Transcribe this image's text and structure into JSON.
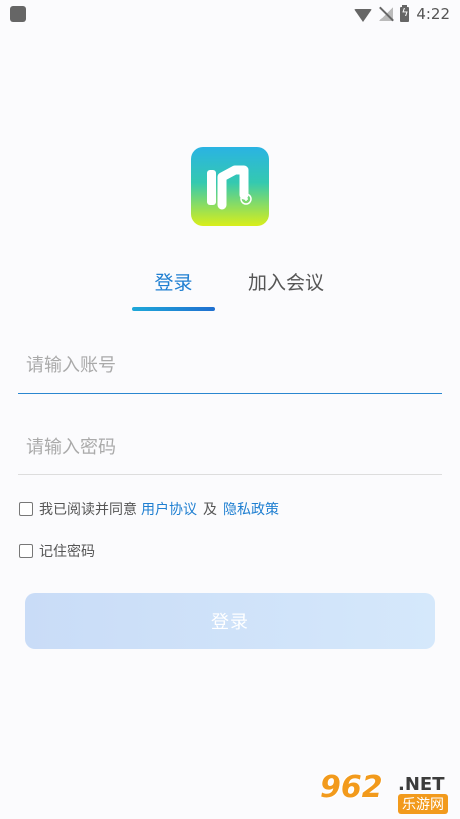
{
  "status_bar": {
    "time": "4:22"
  },
  "tabs": {
    "login": "登录",
    "join": "加入会议"
  },
  "form": {
    "account_placeholder": "请输入账号",
    "password_placeholder": "请输入密码",
    "agree_prefix": "我已阅读并同意",
    "user_agreement": "用户协议",
    "and": "及",
    "privacy_policy": "隐私政策",
    "remember_password": "记住密码",
    "login_button": "登录"
  },
  "watermark": {
    "number": "962",
    "domain": ".NET",
    "cn": "乐游网"
  },
  "colors": {
    "accent": "#1f7fd1",
    "button": "#cfe1f9"
  }
}
